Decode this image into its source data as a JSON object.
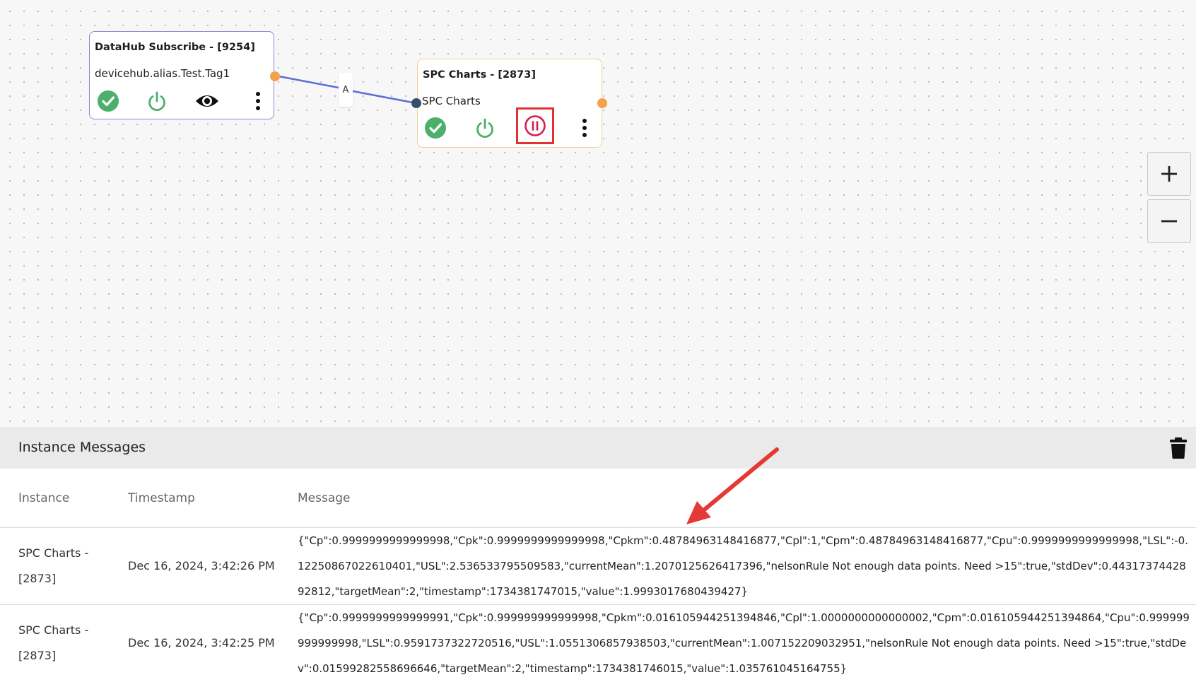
{
  "flow": {
    "nodes": [
      {
        "title": "DataHub Subscribe - [9254]",
        "subtitle": "devicehub.alias.Test.Tag1",
        "border_color": "#8a86d6",
        "icons": [
          "check-circle-icon",
          "power-icon",
          "eye-icon",
          "more-vertical-icon"
        ]
      },
      {
        "title": "SPC Charts - [2873]",
        "subtitle": "SPC Charts",
        "border_color": "#f0cf9a",
        "icons": [
          "check-circle-icon",
          "power-icon",
          "pause-circle-icon",
          "more-vertical-icon"
        ]
      }
    ],
    "edge_label": "A",
    "colors": {
      "edge": "#5b6fd6",
      "port_out": "#f4a14a",
      "port_in": "#35506b",
      "check": "#4caf6a",
      "power": "#4caf6a",
      "pause": "#d81b50",
      "highlight": "#e03232"
    }
  },
  "zoom": {
    "zoom_in_icon": "plus-icon",
    "zoom_out_icon": "minus-icon"
  },
  "panel": {
    "title": "Instance Messages",
    "delete_icon": "trash-icon",
    "columns": [
      "Instance",
      "Timestamp",
      "Message"
    ],
    "rows": [
      {
        "instance": "SPC Charts - [2873]",
        "timestamp": "Dec 16, 2024, 3:42:26 PM",
        "message": "{\"Cp\":0.9999999999999998,\"Cpk\":0.9999999999999998,\"Cpkm\":0.48784963148416877,\"Cpl\":1,\"Cpm\":0.48784963148416877,\"Cpu\":0.9999999999999998,\"LSL\":-0.12250867022610401,\"USL\":2.536533795509583,\"currentMean\":1.2070125626417396,\"nelsonRule Not enough data points. Need >15\":true,\"stdDev\":0.4431737442892812,\"targetMean\":2,\"timestamp\":1734381747015,\"value\":1.9993017680439427}"
      },
      {
        "instance": "SPC Charts - [2873]",
        "timestamp": "Dec 16, 2024, 3:42:25 PM",
        "message": "{\"Cp\":0.9999999999999991,\"Cpk\":0.999999999999998,\"Cpkm\":0.016105944251394846,\"Cpl\":1.0000000000000002,\"Cpm\":0.016105944251394864,\"Cpu\":0.999999999999998,\"LSL\":0.9591737322720516,\"USL\":1.0551306857938503,\"currentMean\":1.007152209032951,\"nelsonRule Not enough data points. Need >15\":true,\"stdDev\":0.01599282558696646,\"targetMean\":2,\"timestamp\":1734381746015,\"value\":1.035761045164755}"
      }
    ]
  },
  "annotation": {
    "arrow_color": "#e53935"
  }
}
